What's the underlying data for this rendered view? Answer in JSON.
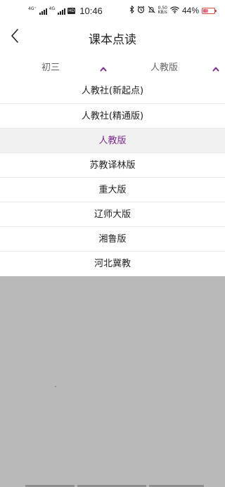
{
  "status_bar": {
    "network_1": "4G⁺",
    "network_2": "4G",
    "hd": "HD",
    "time": "10:46",
    "speed_value": "0.50",
    "speed_unit": "KB/s",
    "battery_percent": "44%",
    "battery_level": 0.44,
    "icons": [
      "bluetooth-icon",
      "alarm-icon",
      "mute-icon",
      "wifi-icon",
      "battery-icon"
    ]
  },
  "nav": {
    "back_icon": "chevron-left-icon",
    "title": "课本点读"
  },
  "filters": {
    "grade": "初三",
    "edition": "人教版",
    "caret_icon": "caret-up-icon",
    "accent_color": "#7b2a8c"
  },
  "dropdown": {
    "options": [
      "人教社(新起点)",
      "人教社(精通版)",
      "人教版",
      "苏教译林版",
      "重大版",
      "辽师大版",
      "湘鲁版",
      "河北冀教"
    ],
    "selected_index": 2
  },
  "colors": {
    "overlay": "#b9b9b9",
    "selected_bg": "#f1f1f1"
  }
}
